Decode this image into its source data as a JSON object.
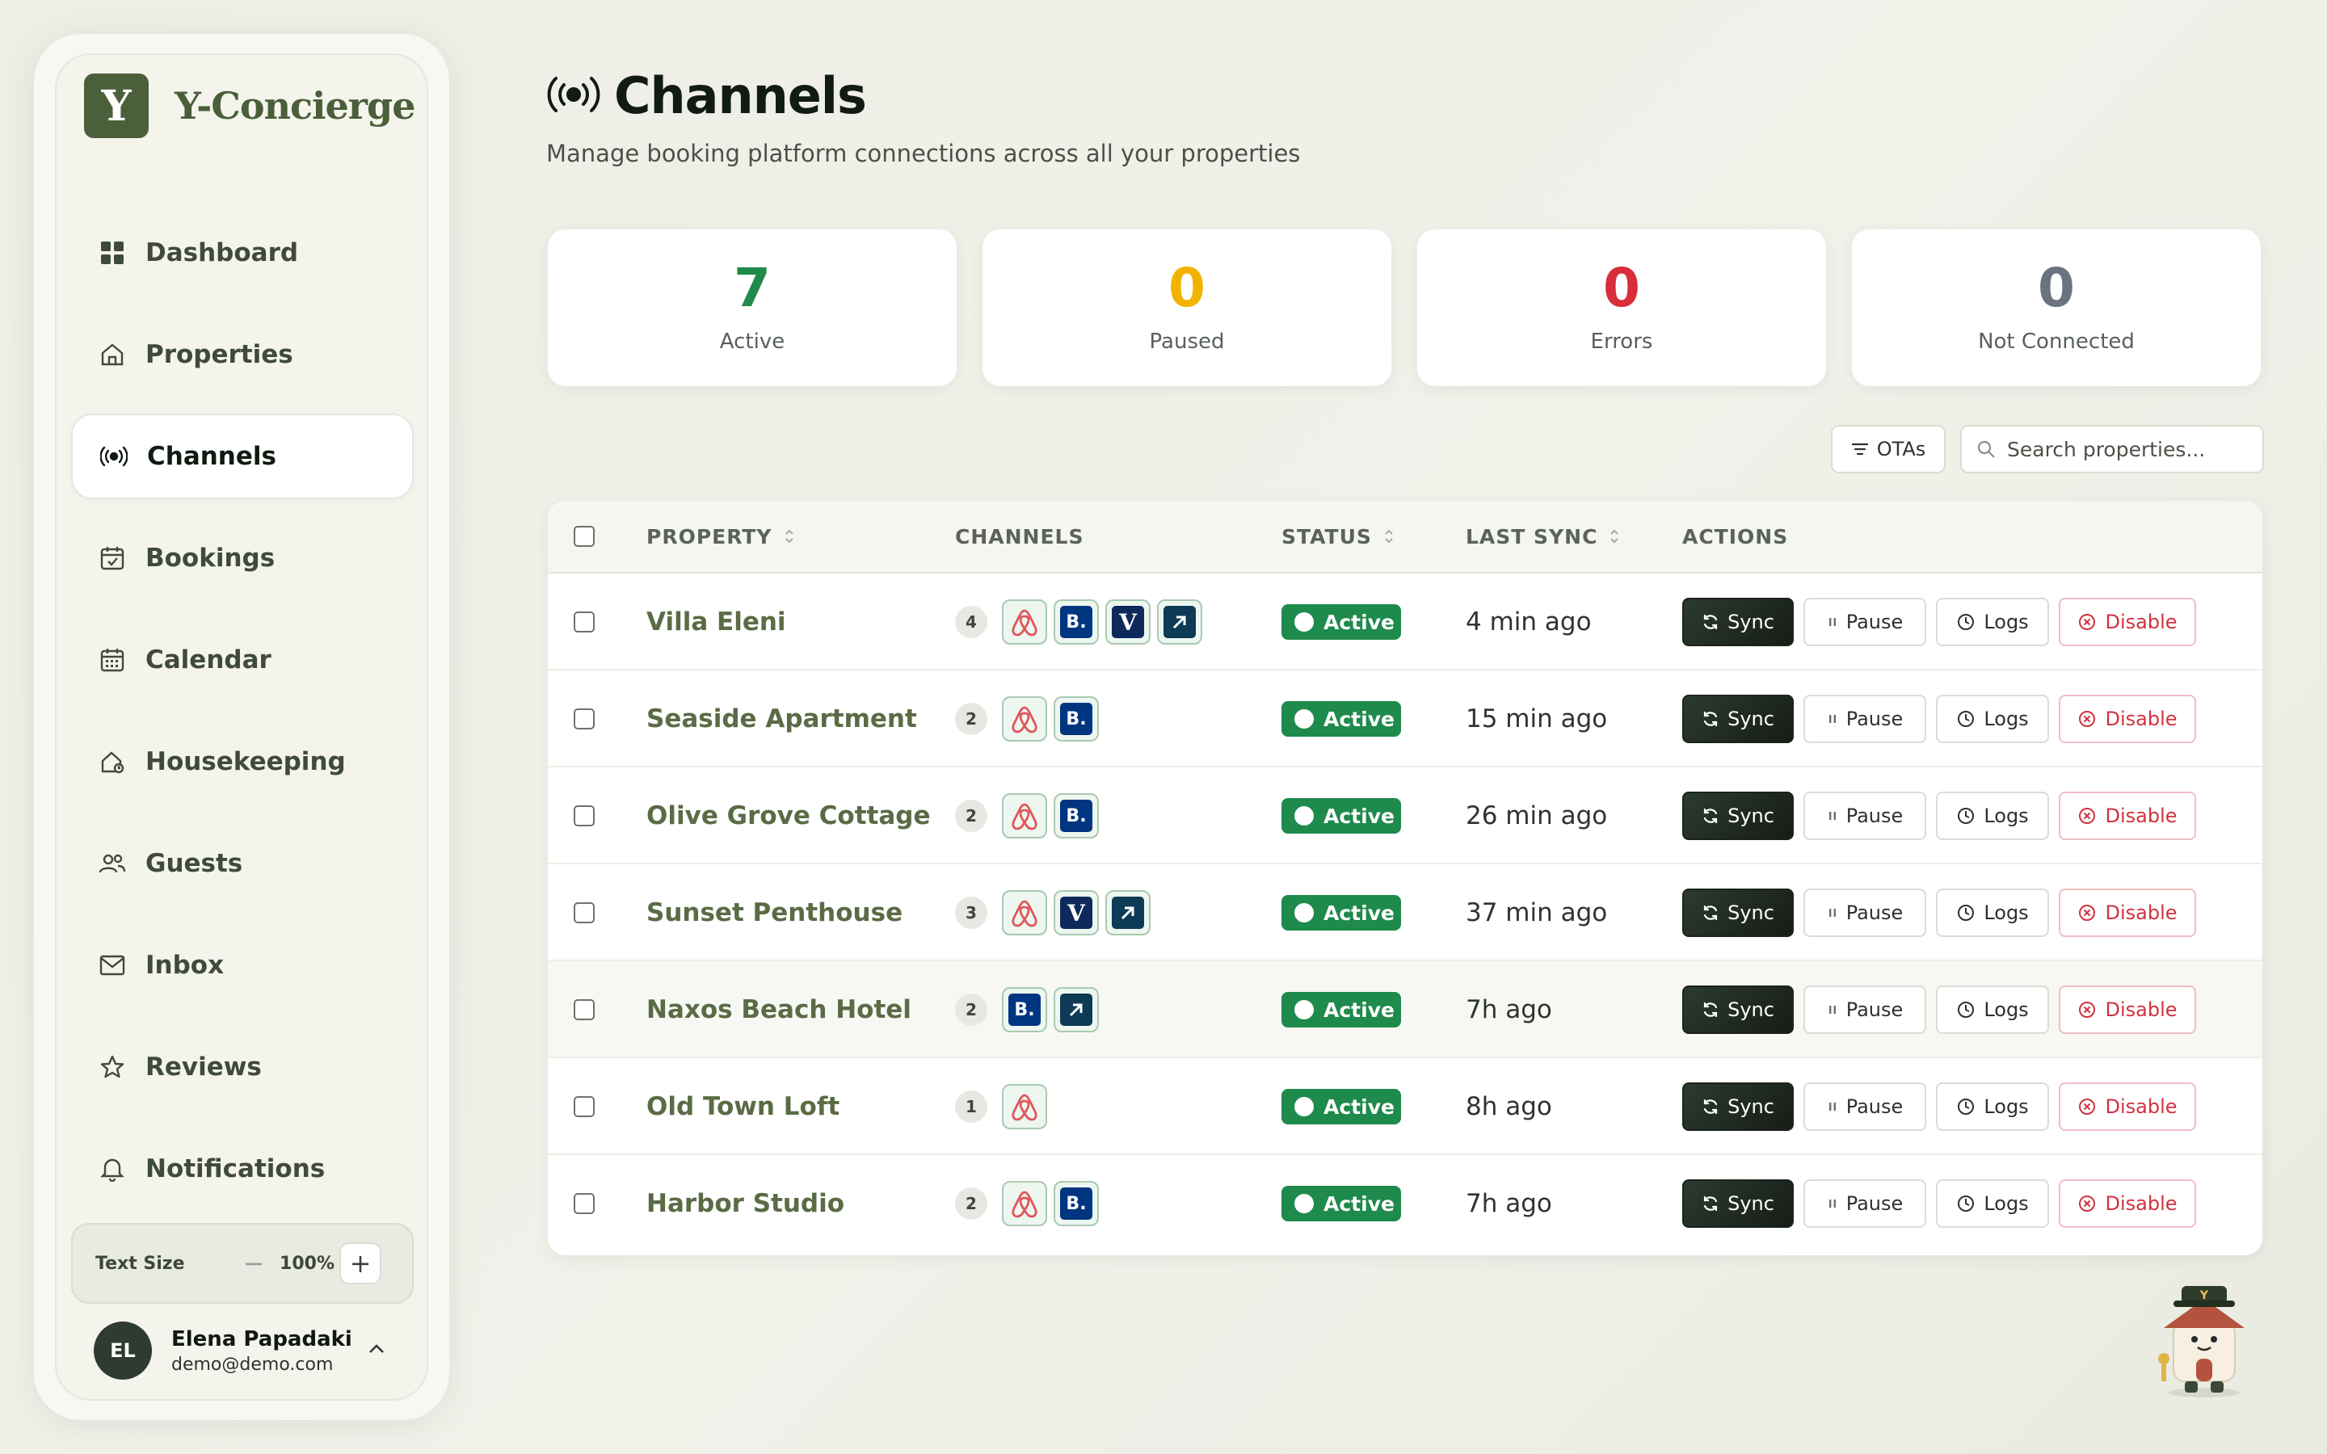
{
  "app": {
    "brand_letter": "Y",
    "brand_name": "Y-Concierge",
    "accent": "#4b5f3b"
  },
  "sidebar": {
    "items": [
      {
        "label": "Dashboard",
        "icon": "grid-icon"
      },
      {
        "label": "Properties",
        "icon": "home-icon"
      },
      {
        "label": "Channels",
        "icon": "broadcast-icon",
        "active": true
      },
      {
        "label": "Bookings",
        "icon": "calendar-check-icon"
      },
      {
        "label": "Calendar",
        "icon": "calendar-grid-icon"
      },
      {
        "label": "Housekeeping",
        "icon": "house-clean-icon"
      },
      {
        "label": "Guests",
        "icon": "users-icon"
      },
      {
        "label": "Inbox",
        "icon": "mail-icon"
      },
      {
        "label": "Reviews",
        "icon": "star-icon"
      },
      {
        "label": "Notifications",
        "icon": "bell-icon"
      }
    ],
    "text_size": {
      "label": "Text Size",
      "value": "100%",
      "minus": "−",
      "plus": "+"
    },
    "user": {
      "initials": "EL",
      "name": "Elena Papadaki",
      "email": "demo@demo.com"
    }
  },
  "header": {
    "title": "Channels",
    "subtitle": "Manage booking platform connections across all your properties"
  },
  "stats": [
    {
      "value": "7",
      "label": "Active",
      "color": "#1f8a4c"
    },
    {
      "value": "0",
      "label": "Paused",
      "color": "#f0b400"
    },
    {
      "value": "0",
      "label": "Errors",
      "color": "#d92d3a"
    },
    {
      "value": "0",
      "label": "Not Connected",
      "color": "#6b7280"
    }
  ],
  "toolbar": {
    "ota_label": "OTAs",
    "search_placeholder": "Search properties..."
  },
  "table": {
    "columns": [
      "PROPERTY",
      "CHANNELS",
      "STATUS",
      "LAST SYNC",
      "ACTIONS"
    ],
    "actions": {
      "sync": "Sync",
      "pause": "Pause",
      "logs": "Logs",
      "disable": "Disable"
    },
    "rows": [
      {
        "property": "Villa Eleni",
        "count": "4",
        "channels": [
          "airbnb",
          "booking",
          "vrbo",
          "expedia"
        ],
        "status": "Active",
        "last_sync": "4 min ago"
      },
      {
        "property": "Seaside Apartment",
        "count": "2",
        "channels": [
          "airbnb",
          "booking"
        ],
        "status": "Active",
        "last_sync": "15 min ago"
      },
      {
        "property": "Olive Grove Cottage",
        "count": "2",
        "channels": [
          "airbnb",
          "booking"
        ],
        "status": "Active",
        "last_sync": "26 min ago"
      },
      {
        "property": "Sunset Penthouse",
        "count": "3",
        "channels": [
          "airbnb",
          "vrbo",
          "expedia"
        ],
        "status": "Active",
        "last_sync": "37 min ago"
      },
      {
        "property": "Naxos Beach Hotel",
        "count": "2",
        "channels": [
          "booking",
          "expedia"
        ],
        "status": "Active",
        "last_sync": "7h ago"
      },
      {
        "property": "Old Town Loft",
        "count": "1",
        "channels": [
          "airbnb"
        ],
        "status": "Active",
        "last_sync": "8h ago"
      },
      {
        "property": "Harbor Studio",
        "count": "2",
        "channels": [
          "airbnb",
          "booking"
        ],
        "status": "Active",
        "last_sync": "7h ago"
      }
    ]
  },
  "channel_styles": {
    "airbnb": {
      "letter": "",
      "color": "#e0565b"
    },
    "booking": {
      "letter": "B.",
      "color": "#003580"
    },
    "vrbo": {
      "letter": "V",
      "color": "#0e2a5c"
    },
    "expedia": {
      "letter": "",
      "color": "#0d3a55"
    }
  }
}
